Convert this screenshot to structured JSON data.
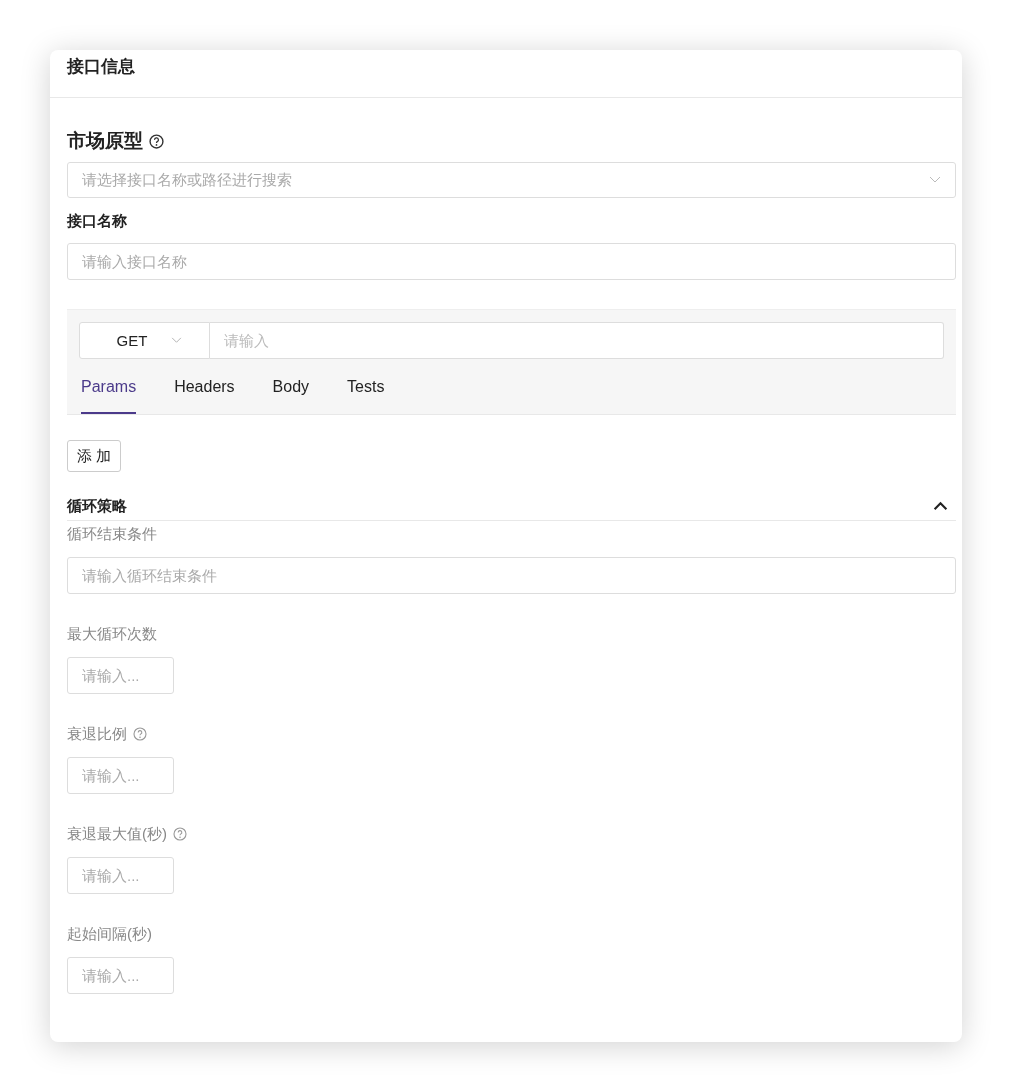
{
  "card": {
    "title": "接口信息"
  },
  "prototype": {
    "label": "市场原型",
    "help": true,
    "select": {
      "placeholder": "请选择接口名称或路径进行搜索"
    }
  },
  "name_field": {
    "label": "接口名称",
    "placeholder": "请输入接口名称"
  },
  "request": {
    "method": "GET",
    "url": {
      "placeholder": "请输入"
    },
    "tabs": [
      {
        "label": "Params",
        "selected": true
      },
      {
        "label": "Headers",
        "selected": false
      },
      {
        "label": "Body",
        "selected": false
      },
      {
        "label": "Tests",
        "selected": false
      }
    ]
  },
  "add_button": "添 加",
  "loop_section": {
    "title": "循环策略",
    "expanded": true,
    "fields": [
      {
        "kind": "wide",
        "label": "循环结束条件",
        "help": false,
        "placeholder": "请输入循环结束条件"
      },
      {
        "kind": "small",
        "label": "最大循环次数",
        "help": false,
        "placeholder": "请输入..."
      },
      {
        "kind": "small",
        "label": "衰退比例",
        "help": true,
        "placeholder": "请输入..."
      },
      {
        "kind": "small",
        "label": "衰退最大值(秒)",
        "help": true,
        "placeholder": "请输入..."
      },
      {
        "kind": "small",
        "label": "起始间隔(秒)",
        "help": false,
        "placeholder": "请输入..."
      }
    ]
  }
}
